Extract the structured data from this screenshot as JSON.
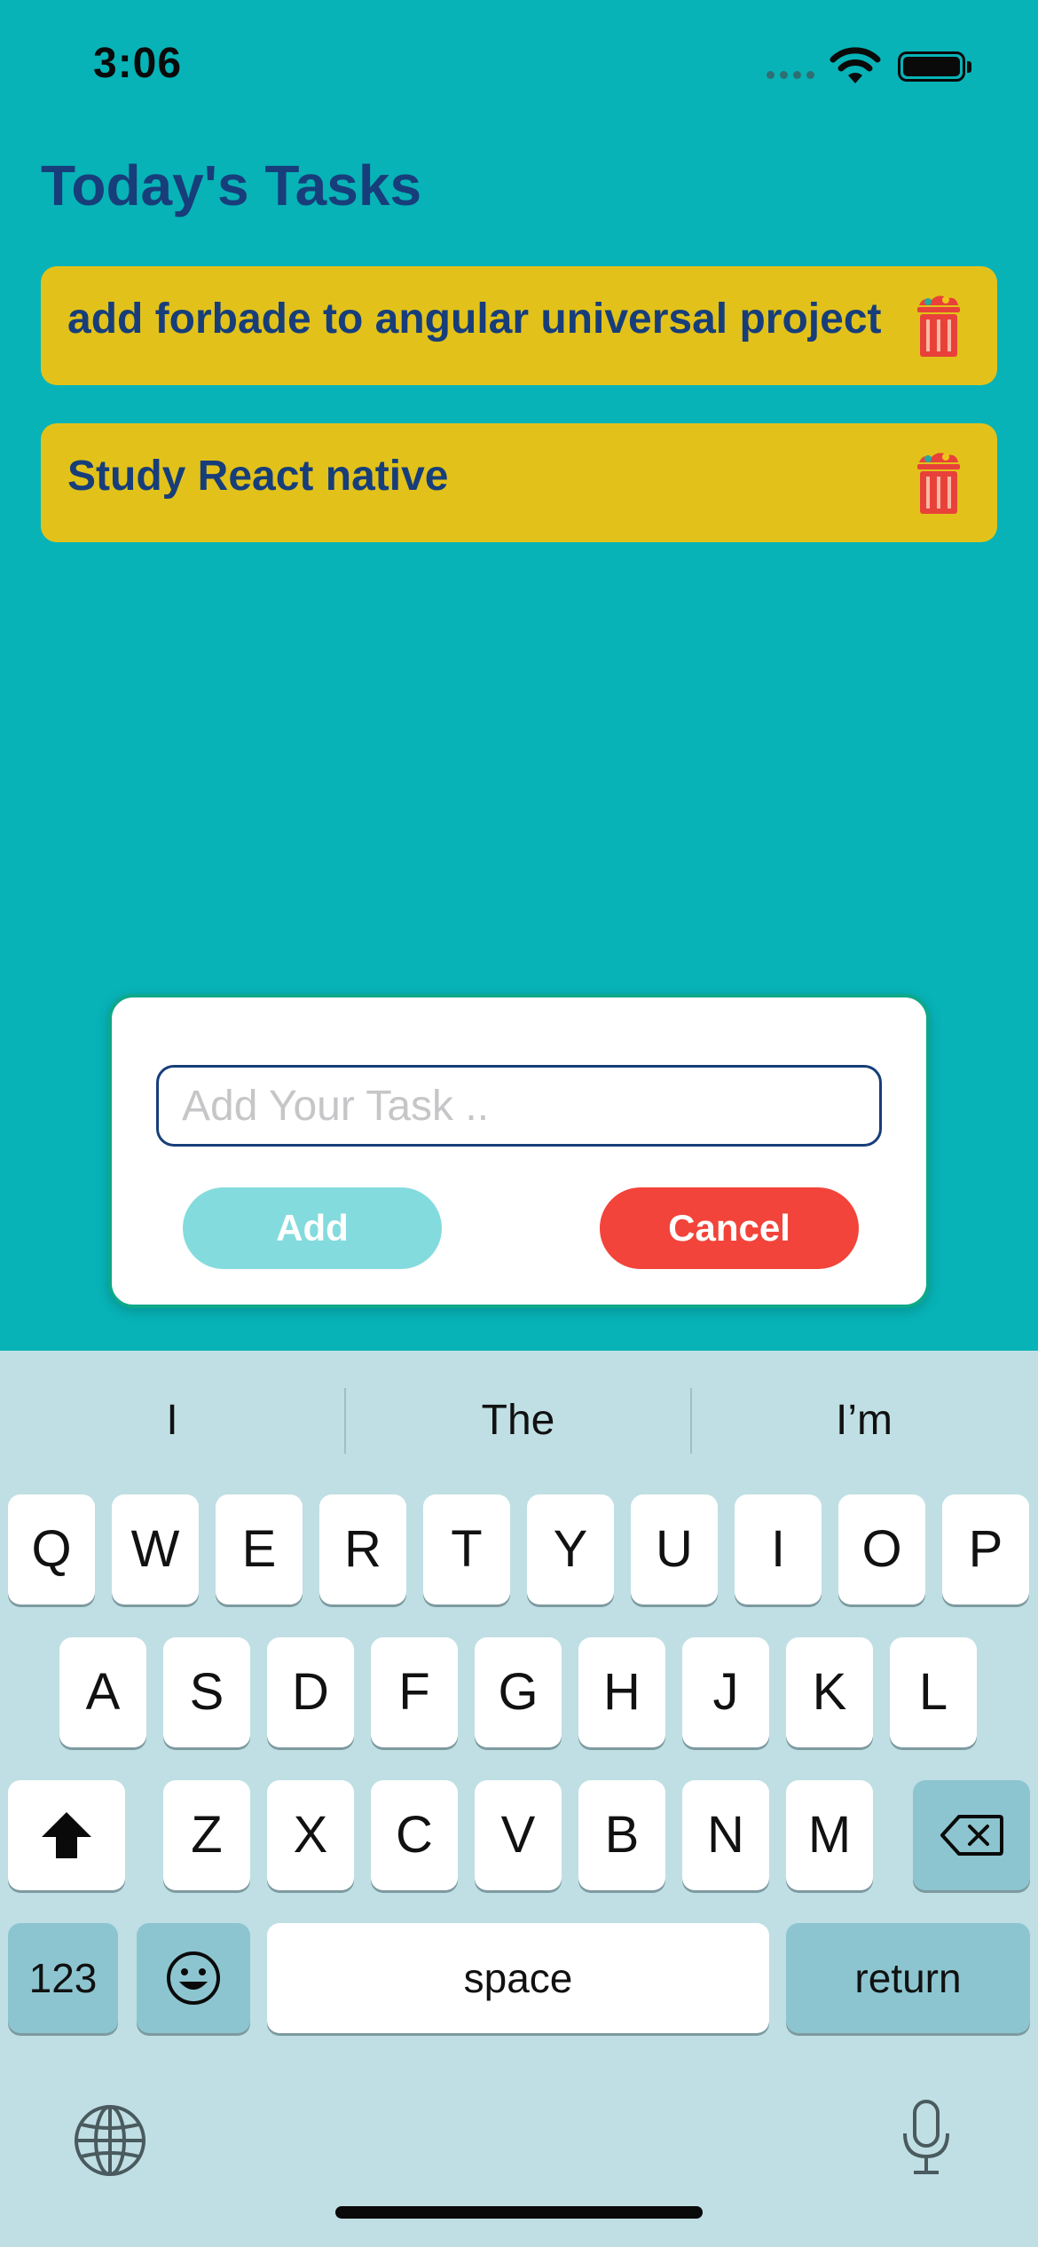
{
  "status_bar": {
    "time": "3:06"
  },
  "title": "Today's Tasks",
  "tasks": [
    {
      "text": "add forbade to angular universal project"
    },
    {
      "text": "Study React native"
    }
  ],
  "modal": {
    "input_placeholder": "Add Your Task ..",
    "input_value": "",
    "add_label": "Add",
    "cancel_label": "Cancel"
  },
  "keyboard": {
    "suggestions": [
      "I",
      "The",
      "I’m"
    ],
    "row1": [
      "Q",
      "W",
      "E",
      "R",
      "T",
      "Y",
      "U",
      "I",
      "O",
      "P"
    ],
    "row2": [
      "A",
      "S",
      "D",
      "F",
      "G",
      "H",
      "J",
      "K",
      "L"
    ],
    "row3": [
      "Z",
      "X",
      "C",
      "V",
      "B",
      "N",
      "M"
    ],
    "numbers_label": "123",
    "space_label": "space",
    "return_label": "return"
  },
  "colors": {
    "background": "#07b3b7",
    "task_card": "#e2c21a",
    "title_text": "#173e7a",
    "add_button": "#84dbdd",
    "cancel_button": "#f2443a",
    "keyboard_bg": "#bfdfe4"
  }
}
